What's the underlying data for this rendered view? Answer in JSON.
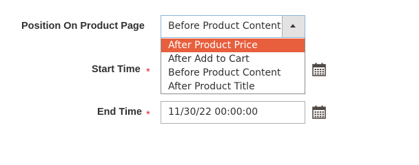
{
  "position_field": {
    "label": "Position On Product Page",
    "value": "Before Product Content",
    "options": [
      {
        "label": "After Product Price",
        "selected": true
      },
      {
        "label": "After Add to Cart",
        "selected": false
      },
      {
        "label": "Before Product Content",
        "selected": false
      },
      {
        "label": "After Product Title",
        "selected": false
      }
    ]
  },
  "start_time_field": {
    "label": "Start Time",
    "required_mark": "*",
    "value": ""
  },
  "end_time_field": {
    "label": "End Time",
    "required_mark": "*",
    "value": "11/30/22 00:00:00"
  },
  "colors": {
    "highlight": "#e85f3e",
    "required": "#e22626",
    "text": "#303030",
    "focus_border": "#8ab4d4"
  },
  "icons": {
    "dropdown_toggle": "arrow-up-icon",
    "date_picker": "calendar-icon"
  }
}
